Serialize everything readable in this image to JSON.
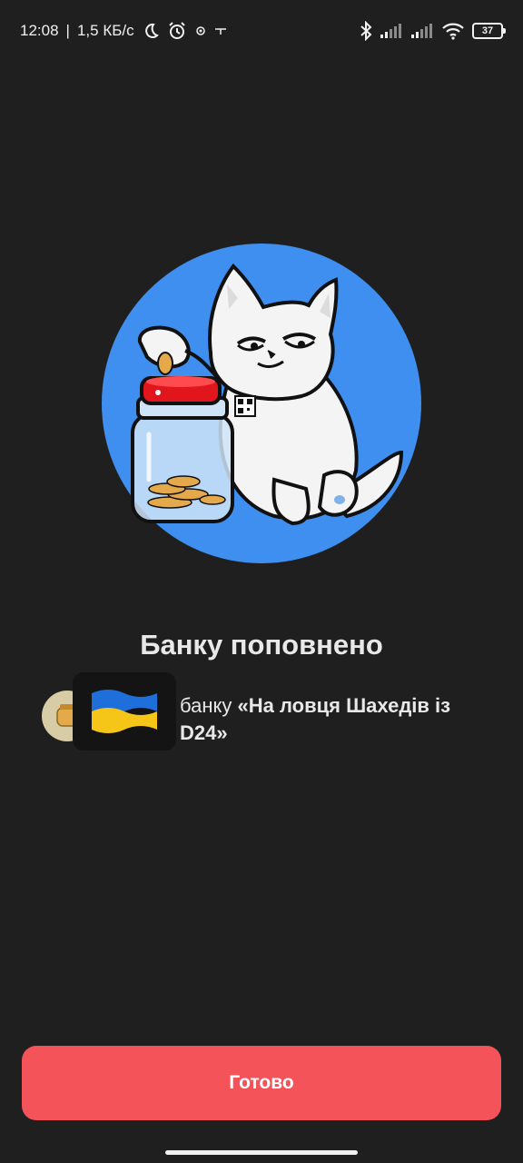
{
  "status_bar": {
    "time": "12:08",
    "network_speed": "1,5 КБ/с",
    "battery_level": "37",
    "icons": [
      "moon-icon",
      "alarm-icon",
      "vpn-icon",
      "key-icon",
      "bluetooth-icon",
      "signal-icon",
      "signal-icon-2",
      "wifi-icon",
      "battery-icon"
    ]
  },
  "illustration": {
    "description_icon": "cat-with-jar-illustration",
    "circle_color": "#3f8ff0"
  },
  "main": {
    "title": "Банку поповнено",
    "description_prefix": "банку",
    "jar_name_line1": "«На ловця Шахедів із",
    "jar_name_line2": "D24»",
    "flag_icon": "ukraine-flag-icon",
    "avatar_icon": "jar-avatar-icon"
  },
  "actions": {
    "done_label": "Готово"
  },
  "colors": {
    "background": "#1f1f1f",
    "accent": "#f4535a",
    "text": "#e8e8e8"
  }
}
